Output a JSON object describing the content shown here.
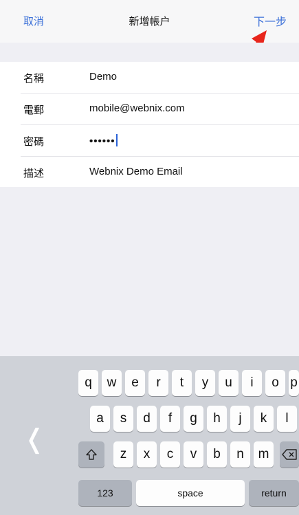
{
  "nav": {
    "cancel_label": "取消",
    "title": "新增帳户",
    "next_label": "下一步"
  },
  "annotation": {
    "arrow_color": "#e8251b"
  },
  "colors": {
    "accent": "#3a6fd8"
  },
  "form": {
    "rows": [
      {
        "label": "名稱",
        "value": "Demo"
      },
      {
        "label": "電郵",
        "value": "mobile@webnix.com"
      },
      {
        "label": "密碼",
        "value": "••••••"
      },
      {
        "label": "描述",
        "value": "Webnix Demo Email"
      }
    ]
  },
  "keyboard": {
    "row1": [
      "q",
      "w",
      "e",
      "r",
      "t",
      "y",
      "u",
      "i",
      "o",
      "p"
    ],
    "row2": [
      "a",
      "s",
      "d",
      "f",
      "g",
      "h",
      "j",
      "k",
      "l"
    ],
    "row3": [
      "z",
      "x",
      "c",
      "v",
      "b",
      "n",
      "m"
    ],
    "shift_icon": "shift-arrow-icon",
    "delete_icon": "backspace-icon",
    "numbers_label": "123",
    "space_label": "space",
    "return_label": "return",
    "collapse_icon": "chevron-left-icon"
  }
}
